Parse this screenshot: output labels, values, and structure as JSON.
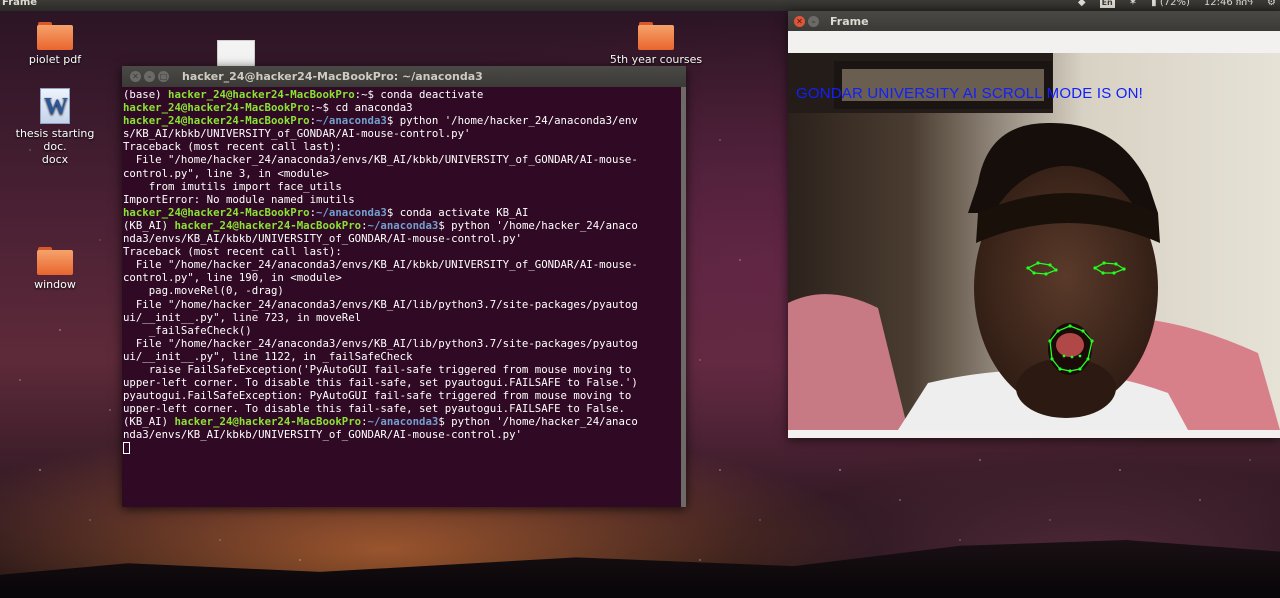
{
  "top_panel": {
    "app_title": "Frame",
    "keyboard_layout": "En",
    "battery": "(72%)",
    "clock": "12:46 ክሰዓ"
  },
  "desktop_icons": [
    {
      "label": "piolet pdf",
      "icon": "folder-icon"
    },
    {
      "label": "thesis starting doc.\ndocx",
      "icon": "word-document-icon"
    },
    {
      "label": "window",
      "icon": "folder-icon"
    },
    {
      "label": "5th year courses",
      "icon": "folder-icon"
    },
    {
      "label": "",
      "icon": "document-thumbnail-icon"
    }
  ],
  "terminal": {
    "title": "hacker_24@hacker24-MacBookPro: ~/anaconda3",
    "lines": [
      [
        {
          "t": "(base) "
        },
        {
          "t": "hacker_24@hacker24-MacBookPro",
          "c": "pu"
        },
        {
          "t": ":~$ conda deactivate"
        }
      ],
      [
        {
          "t": "hacker_24@hacker24-MacBookPro",
          "c": "pu"
        },
        {
          "t": ":~$ cd anaconda3"
        }
      ],
      [
        {
          "t": "hacker_24@hacker24-MacBookPro",
          "c": "pu"
        },
        {
          "t": ":"
        },
        {
          "t": "~/anaconda3",
          "c": "pd"
        },
        {
          "t": "$ python '/home/hacker_24/anaconda3/env"
        }
      ],
      [
        {
          "t": "s/KB_AI/kbkb/UNIVERSITY_of_GONDAR/AI-mouse-control.py'"
        }
      ],
      [
        {
          "t": "Traceback (most recent call last):"
        }
      ],
      [
        {
          "t": "  File \"/home/hacker_24/anaconda3/envs/KB_AI/kbkb/UNIVERSITY_of_GONDAR/AI-mouse-"
        }
      ],
      [
        {
          "t": "control.py\", line 3, in <module>"
        }
      ],
      [
        {
          "t": "    from imutils import face_utils"
        }
      ],
      [
        {
          "t": "ImportError: No module named imutils"
        }
      ],
      [
        {
          "t": "hacker_24@hacker24-MacBookPro",
          "c": "pu"
        },
        {
          "t": ":"
        },
        {
          "t": "~/anaconda3",
          "c": "pd"
        },
        {
          "t": "$ conda activate KB_AI"
        }
      ],
      [
        {
          "t": "(KB_AI) "
        },
        {
          "t": "hacker_24@hacker24-MacBookPro",
          "c": "pu"
        },
        {
          "t": ":"
        },
        {
          "t": "~/anaconda3",
          "c": "pd"
        },
        {
          "t": "$ python '/home/hacker_24/anaco"
        }
      ],
      [
        {
          "t": "nda3/envs/KB_AI/kbkb/UNIVERSITY_of_GONDAR/AI-mouse-control.py'"
        }
      ],
      [
        {
          "t": "Traceback (most recent call last):"
        }
      ],
      [
        {
          "t": "  File \"/home/hacker_24/anaconda3/envs/KB_AI/kbkb/UNIVERSITY_of_GONDAR/AI-mouse-"
        }
      ],
      [
        {
          "t": "control.py\", line 190, in <module>"
        }
      ],
      [
        {
          "t": "    pag.moveRel(0, -drag)"
        }
      ],
      [
        {
          "t": "  File \"/home/hacker_24/anaconda3/envs/KB_AI/lib/python3.7/site-packages/pyautog"
        }
      ],
      [
        {
          "t": "ui/__init__.py\", line 723, in moveRel"
        }
      ],
      [
        {
          "t": "    _failSafeCheck()"
        }
      ],
      [
        {
          "t": "  File \"/home/hacker_24/anaconda3/envs/KB_AI/lib/python3.7/site-packages/pyautog"
        }
      ],
      [
        {
          "t": "ui/__init__.py\", line 1122, in _failSafeCheck"
        }
      ],
      [
        {
          "t": "    raise FailSafeException('PyAutoGUI fail-safe triggered from mouse moving to"
        }
      ],
      [
        {
          "t": "upper-left corner. To disable this fail-safe, set pyautogui.FAILSAFE to False.')"
        }
      ],
      [
        {
          "t": "pyautogui.FailSafeException: PyAutoGUI fail-safe triggered from mouse moving to"
        }
      ],
      [
        {
          "t": "upper-left corner. To disable this fail-safe, set pyautogui.FAILSAFE to False."
        }
      ],
      [
        {
          "t": "(KB_AI) "
        },
        {
          "t": "hacker_24@hacker24-MacBookPro",
          "c": "pu"
        },
        {
          "t": ":"
        },
        {
          "t": "~/anaconda3",
          "c": "pd"
        },
        {
          "t": "$ python '/home/hacker_24/anaco"
        }
      ],
      [
        {
          "t": "nda3/envs/KB_AI/kbkb/UNIVERSITY_of_GONDAR/AI-mouse-control.py'"
        }
      ]
    ]
  },
  "frame_window": {
    "title": "Frame",
    "overlay_text": "GONDAR UNIVERSITY AI SCROLL MODE IS ON!",
    "overlay_color": "#1020ff",
    "landmark_color": "#22ff22"
  }
}
